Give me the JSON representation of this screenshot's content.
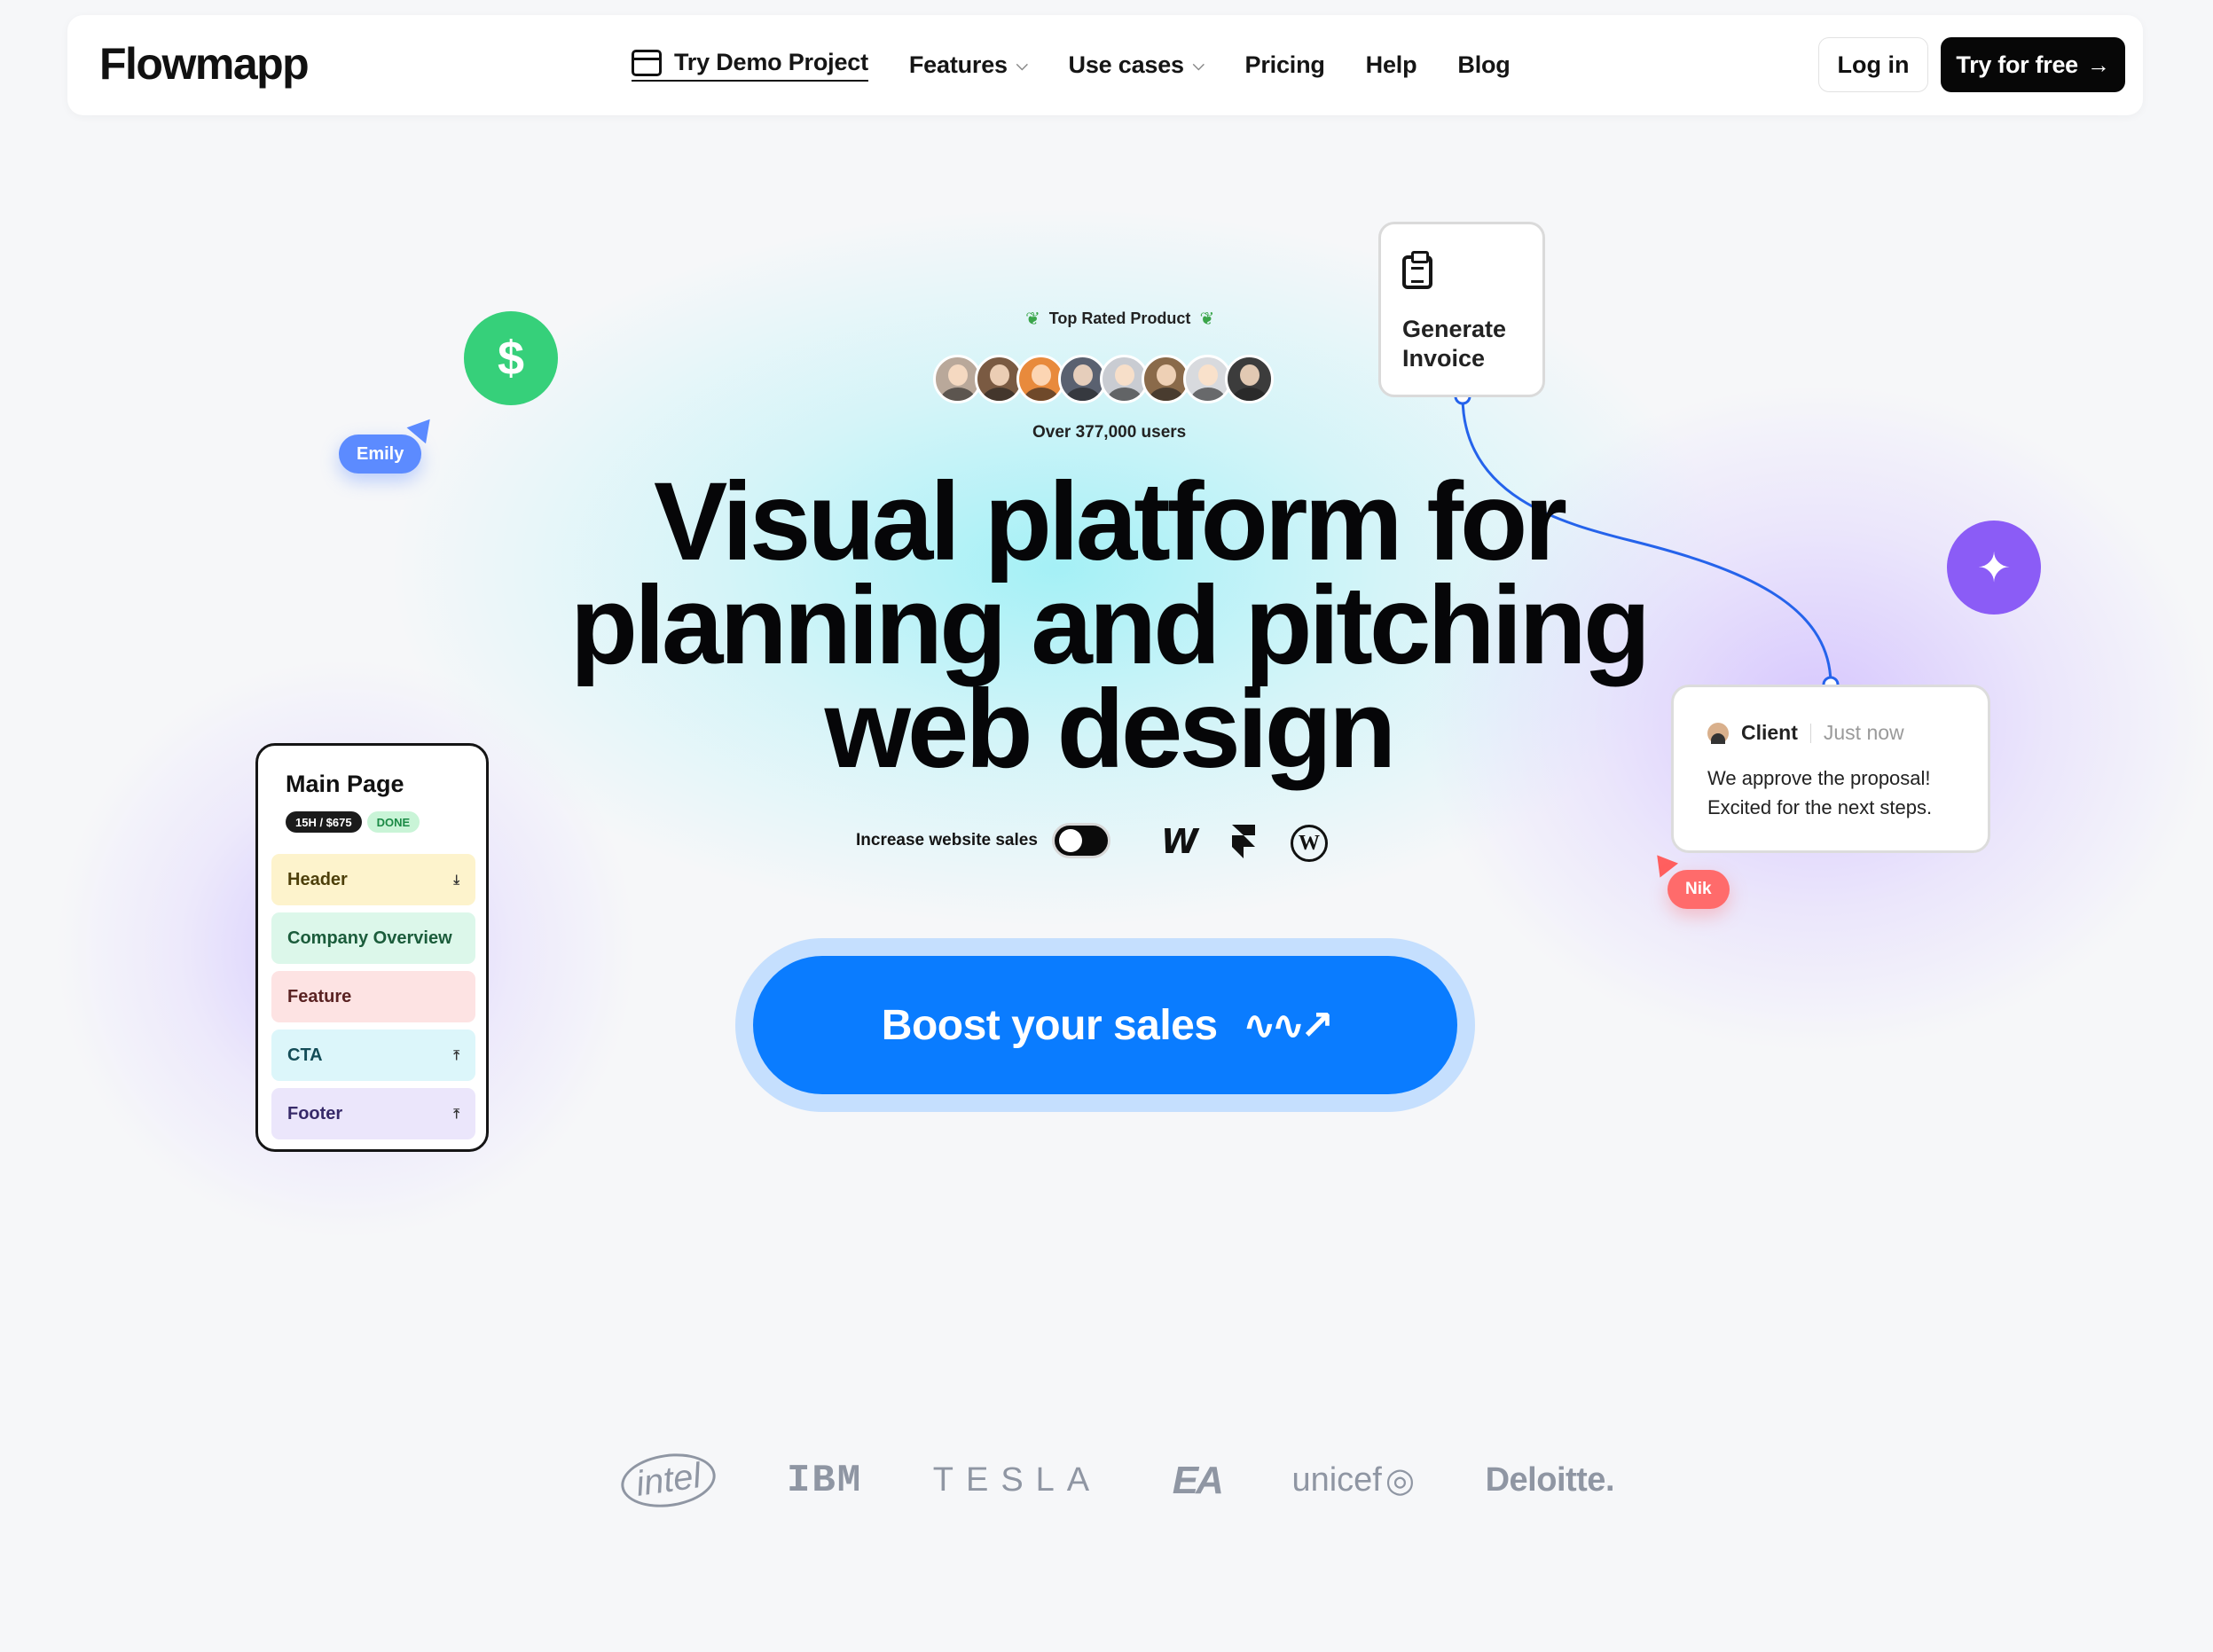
{
  "nav": {
    "logo": "Flowmapp",
    "links": [
      {
        "label": "Try Demo Project"
      },
      {
        "label": "Features"
      },
      {
        "label": "Use cases"
      },
      {
        "label": "Pricing"
      },
      {
        "label": "Help"
      },
      {
        "label": "Blog"
      }
    ],
    "login": "Log in",
    "try_free": "Try for free",
    "try_free_arrow": "→"
  },
  "hero": {
    "badge": "Top Rated Product",
    "users": "Over 377,000 users",
    "headline": "Visual platform for planning and pitching web design",
    "toggle_label": "Increase website sales",
    "cta": "Boost your sales",
    "cta_icon": "∿∿↗"
  },
  "floating": {
    "dollar_icon": "$",
    "emily": "Emily",
    "invoice": "Generate Invoice",
    "sparkle_icon": "✦",
    "client": {
      "name": "Client",
      "time": "Just now",
      "message": "We approve the proposal! Excited for the next steps."
    },
    "nik": "Nik"
  },
  "page_card": {
    "title": "Main Page",
    "tag_estimate": "15H / $675",
    "tag_status": "DONE",
    "rows": [
      {
        "label": "Header"
      },
      {
        "label": "Company Overview"
      },
      {
        "label": "Feature"
      },
      {
        "label": "CTA"
      },
      {
        "label": "Footer"
      }
    ]
  },
  "logos": [
    "intel",
    "IBM",
    "TESLA",
    "EA",
    "unicef",
    "Deloitte."
  ],
  "colors": {
    "accent_blue": "#0a7cff",
    "green": "#36d07a",
    "purple": "#8b5cf6",
    "emily_blue": "#5c8bff",
    "nik_red": "#ff6b6b"
  }
}
